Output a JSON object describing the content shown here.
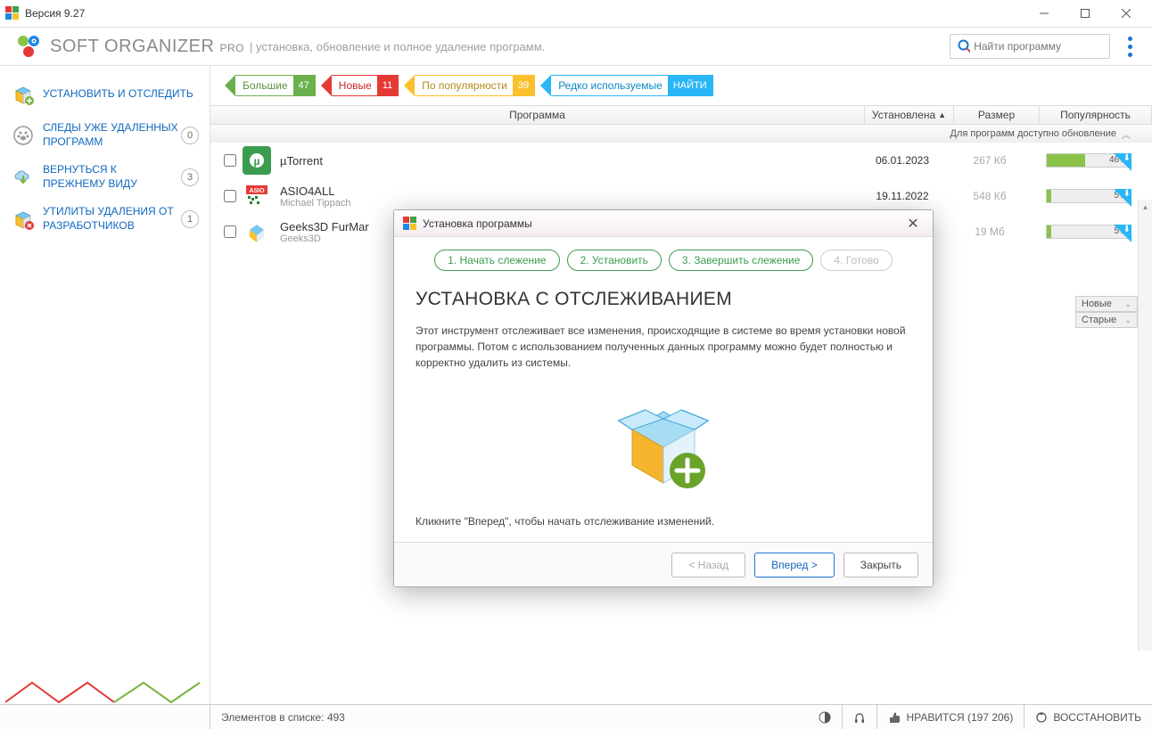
{
  "titlebar": {
    "version": "Версия 9.27"
  },
  "header": {
    "app": "SOFT ORGANIZER",
    "edition": "PRO",
    "subtitle": "| установка, обновление и полное удаление программ.",
    "search_placeholder": "Найти программу"
  },
  "sidebar": {
    "items": [
      {
        "label": "УСТАНОВИТЬ И ОТСЛЕДИТЬ",
        "badge": ""
      },
      {
        "label": "СЛЕДЫ УЖЕ УДАЛЕННЫХ ПРОГРАММ",
        "badge": "0"
      },
      {
        "label": "ВЕРНУТЬСЯ К ПРЕЖНЕМУ ВИДУ",
        "badge": "3"
      },
      {
        "label": "УТИЛИТЫ УДАЛЕНИЯ ОТ РАЗРАБОТЧИКОВ",
        "badge": "1"
      }
    ]
  },
  "filters": [
    {
      "label": "Большие",
      "count": "47"
    },
    {
      "label": "Новые",
      "count": "11"
    },
    {
      "label": "По популярности",
      "count": "39"
    },
    {
      "label": "Редко используемые",
      "count": "НАЙТИ"
    }
  ],
  "columns": {
    "program": "Программа",
    "installed": "Установлена",
    "size": "Размер",
    "popularity": "Популярность"
  },
  "update_banner": "Для программ доступно обновление",
  "programs": [
    {
      "name": "µTorrent",
      "vendor": "",
      "date": "06.01.2023",
      "size": "267 Кб",
      "pop": "46%",
      "pop_w": 46
    },
    {
      "name": "ASIO4ALL",
      "vendor": "Michael Tippach",
      "date": "19.11.2022",
      "size": "548 Кб",
      "pop": "5%",
      "pop_w": 5
    },
    {
      "name": "Geeks3D FurMar",
      "vendor": "Geeks3D",
      "date": "",
      "size": "19 Мб",
      "pop": "5%",
      "pop_w": 5
    }
  ],
  "tags": {
    "new": "Новые",
    "old": "Старые"
  },
  "modal": {
    "title": "Установка программы",
    "steps": [
      "1. Начать слежение",
      "2. Установить",
      "3. Завершить слежение",
      "4. Готово"
    ],
    "heading": "УСТАНОВКА С ОТСЛЕЖИВАНИЕМ",
    "body": "Этот инструмент отслеживает все изменения, происходящие в системе во время установки новой программы. Потом с использованием полученных данных программу можно будет полностью и корректно удалить из системы.",
    "hint": "Кликните \"Вперед\", чтобы начать отслеживание изменений.",
    "back": "< Назад",
    "next": "Вперед >",
    "close": "Закрыть"
  },
  "status": {
    "count": "Элементов в списке: 493",
    "like": "НРАВИТСЯ (197 206)",
    "restore": "ВОССТАНОВИТЬ"
  }
}
